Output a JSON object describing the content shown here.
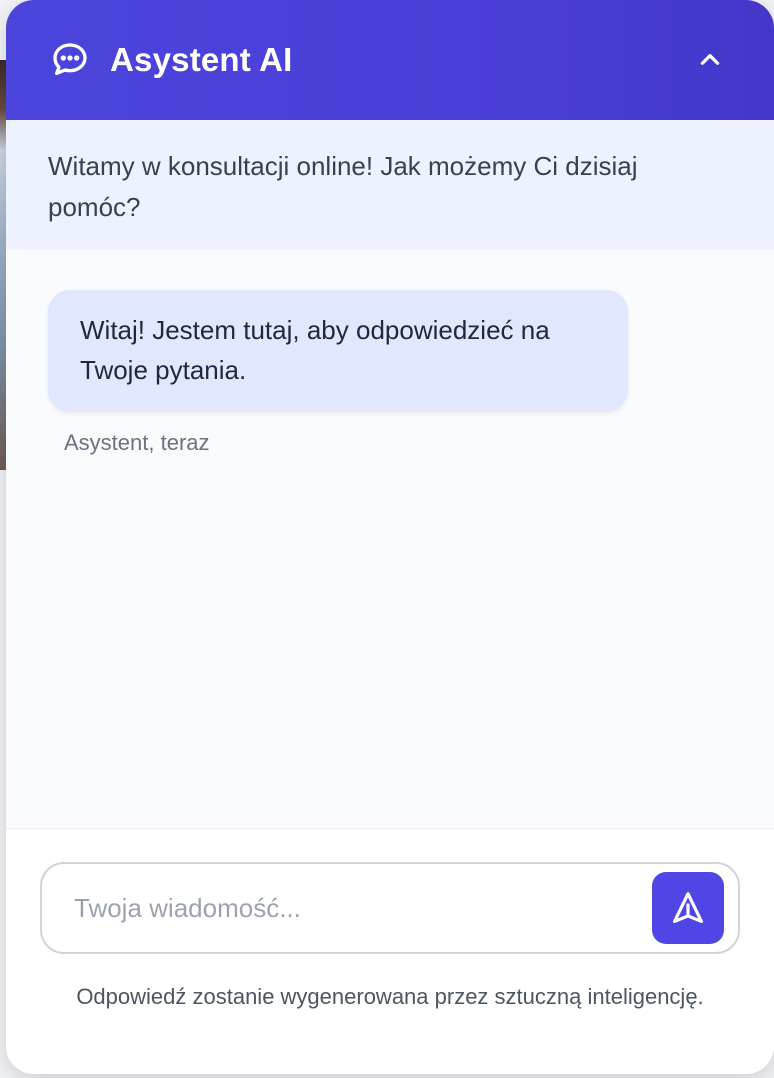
{
  "header": {
    "title": "Asystent AI",
    "chat_icon": "chat-bubble-dots-icon",
    "collapse_icon": "chevron-up-icon"
  },
  "welcome": {
    "text": "Witamy w konsultacji online! Jak możemy Ci dzisiaj pomóc?"
  },
  "messages": [
    {
      "text": "Witaj! Jestem tutaj, aby odpowiedzieć na Twoje pytania.",
      "meta": "Asystent, teraz"
    }
  ],
  "composer": {
    "placeholder": "Twoja wiadomość...",
    "value": "",
    "send_icon": "send-icon"
  },
  "disclaimer": "Odpowiedź zostanie wygenerowana przez sztuczną inteligencję.",
  "colors": {
    "accent": "#4f46e5",
    "header": "#4338ca",
    "bubble": "#e0e7ff",
    "welcome_bg": "#eef2ff"
  }
}
